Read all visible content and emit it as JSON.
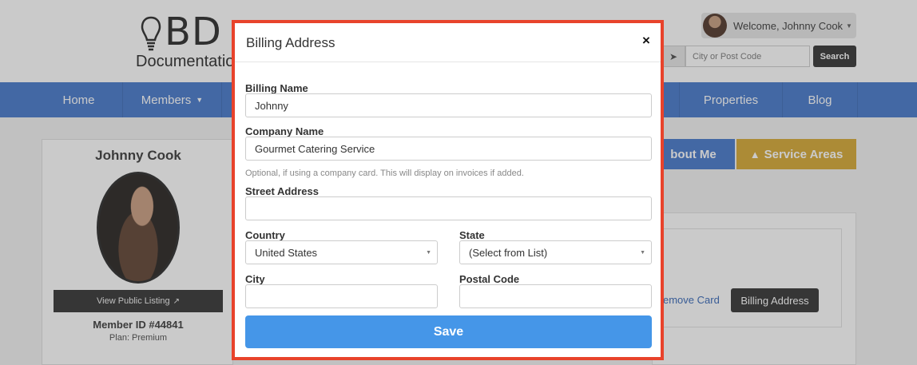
{
  "header": {
    "logo_big": "BD",
    "logo_small": "Documentation",
    "welcome_text": "Welcome, Johnny Cook",
    "city_placeholder": "City or Post Code",
    "search_label": "Search"
  },
  "nav": {
    "items": [
      {
        "label": "Home"
      },
      {
        "label": "Members"
      },
      {
        "label": "Properties"
      },
      {
        "label": "Blog"
      }
    ]
  },
  "profile": {
    "name": "Johnny Cook",
    "view_public_label": "View Public Listing",
    "member_id": "Member ID #44841",
    "plan": "Plan: Premium"
  },
  "tabs": {
    "about_label": "bout Me",
    "service_areas_label": "Service Areas"
  },
  "card_actions": {
    "remove_card_label": "emove Card",
    "billing_address_label": "Billing Address"
  },
  "modal": {
    "title": "Billing Address",
    "close_symbol": "×",
    "billing_name_label": "Billing Name",
    "billing_name_value": "Johnny",
    "company_name_label": "Company Name",
    "company_name_value": "Gourmet Catering Service",
    "company_help": "Optional, if using a company card. This will display on invoices if added.",
    "street_label": "Street Address",
    "street_value": "",
    "country_label": "Country",
    "country_value": "United States",
    "state_label": "State",
    "state_value": "(Select from List)",
    "city_label": "City",
    "city_value": "",
    "postal_label": "Postal Code",
    "postal_value": "",
    "save_label": "Save"
  },
  "colors": {
    "nav_blue": "#3e73c9",
    "service_gold": "#d4a52c",
    "save_blue": "#4596e8",
    "modal_border": "#e8432b"
  }
}
